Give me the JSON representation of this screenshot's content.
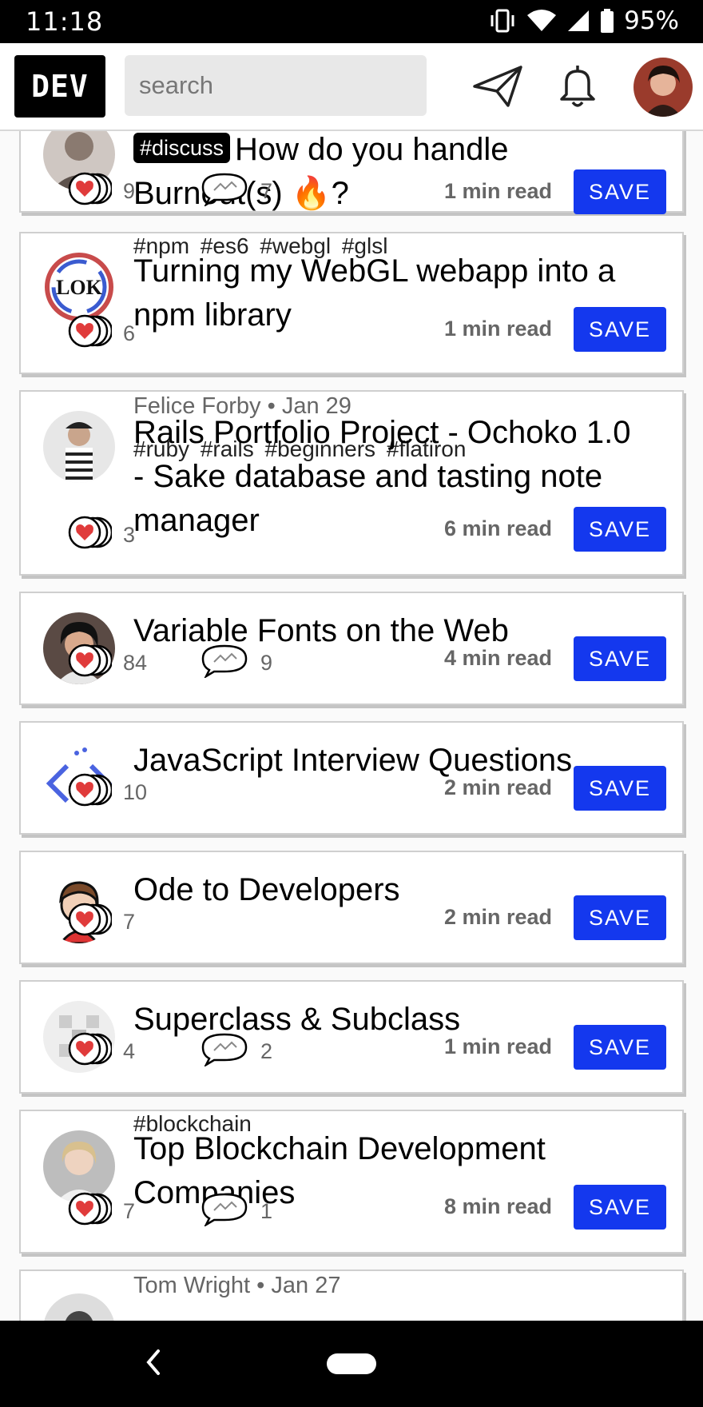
{
  "status_bar": {
    "time": "11:18",
    "battery": "95%"
  },
  "header": {
    "logo": "DEV",
    "search_placeholder": "search"
  },
  "cards": [
    {
      "tag_badge": "#discuss",
      "title": "How do you handle Burnout(s) 🔥?",
      "reactions": "9",
      "comments": "7",
      "read_time": "1 min read",
      "save": "SAVE"
    },
    {
      "tags": "#npm #es6 #webgl #glsl",
      "title": "Turning my WebGL webapp into a npm library",
      "reactions": "6",
      "read_time": "1 min read",
      "save": "SAVE"
    },
    {
      "author": "Felice Forby",
      "date": "Jan 29",
      "tags": "#ruby #rails #beginners #flatiron",
      "title": "Rails Portfolio Project - Ochoko 1.0 - Sake database and tasting note manager",
      "reactions": "3",
      "read_time": "6 min read",
      "save": "SAVE"
    },
    {
      "title": "Variable Fonts on the Web",
      "reactions": "84",
      "comments": "9",
      "read_time": "4 min read",
      "save": "SAVE"
    },
    {
      "title": "JavaScript Interview Questions",
      "reactions": "10",
      "read_time": "2 min read",
      "save": "SAVE"
    },
    {
      "title": "Ode to Developers",
      "reactions": "7",
      "read_time": "2 min read",
      "save": "SAVE"
    },
    {
      "title": "Superclass & Subclass",
      "reactions": "4",
      "comments": "2",
      "read_time": "1 min read",
      "save": "SAVE"
    },
    {
      "tags": "#blockchain",
      "title": "Top Blockchain Development Companies",
      "reactions": "7",
      "comments": "1",
      "read_time": "8 min read",
      "save": "SAVE"
    },
    {
      "author": "Tom Wright",
      "date": "Jan 27"
    }
  ]
}
